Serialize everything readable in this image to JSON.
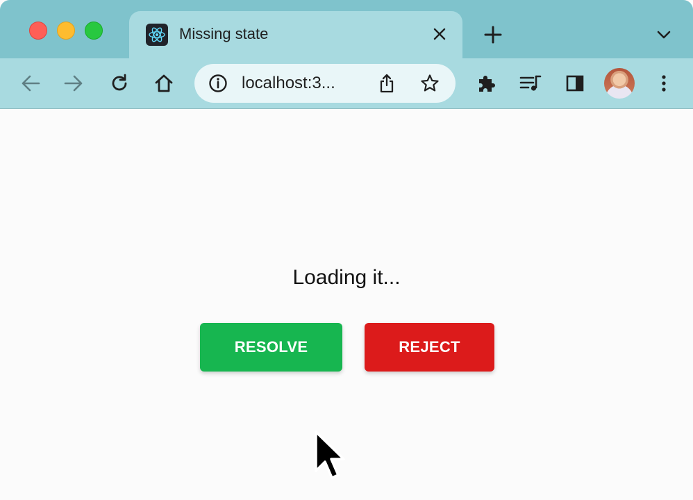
{
  "browser": {
    "tab": {
      "title": "Missing state",
      "favicon": "react-logo-icon"
    },
    "address_bar": {
      "url": "localhost:3..."
    }
  },
  "page": {
    "status_text": "Loading it...",
    "buttons": {
      "resolve_label": "RESOLVE",
      "reject_label": "REJECT"
    }
  },
  "colors": {
    "chrome_frame": "#7fc3cc",
    "chrome_toolbar": "#a8dae0",
    "resolve": "#17b650",
    "reject": "#dc1b1b"
  }
}
